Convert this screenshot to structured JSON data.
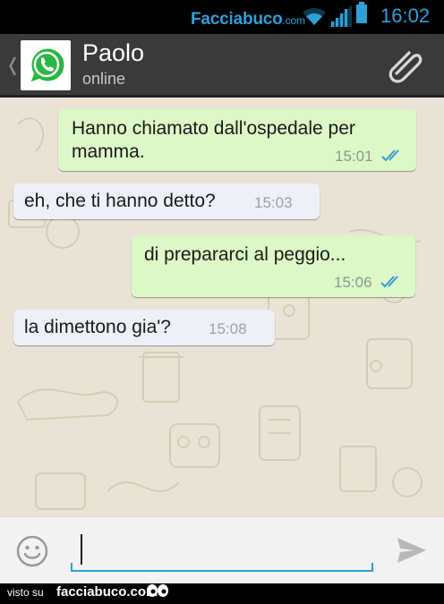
{
  "status_bar": {
    "watermark_main": "Facciabuco",
    "watermark_domain": ".com",
    "time": "16:02",
    "icons": [
      "wifi-icon",
      "signal-icon",
      "battery-icon"
    ],
    "accent_color": "#2f9fd6"
  },
  "header": {
    "contact_name": "Paolo",
    "contact_status": "online",
    "icons": [
      "back-chevron-icon",
      "whatsapp-logo",
      "paperclip-icon"
    ],
    "background": "#3a3a3a"
  },
  "messages": [
    {
      "direction": "outgoing",
      "line1": "Hanno chiamato dall'ospedale per",
      "line2": "mamma.",
      "time": "15:01",
      "ticks": "double-check-icon"
    },
    {
      "direction": "incoming",
      "text": "eh, che ti hanno detto?",
      "time": "15:03"
    },
    {
      "direction": "outgoing",
      "text": "di prepararci al peggio...",
      "time": "15:06",
      "ticks": "double-check-icon"
    },
    {
      "direction": "incoming",
      "text": "la dimettono gia'?",
      "time": "15:08"
    }
  ],
  "colors": {
    "outgoing_bubble": "#dcf8c6",
    "incoming_bubble": "#eef0f8",
    "chat_background": "#e8e3d4",
    "read_ticks": "#3a9ad9"
  },
  "input_bar": {
    "value": "",
    "icons": [
      "emoji-icon",
      "send-icon"
    ]
  },
  "footer": {
    "prefix": "visto su",
    "site": "facciabuco.com",
    "icon": "eyes-icon"
  }
}
